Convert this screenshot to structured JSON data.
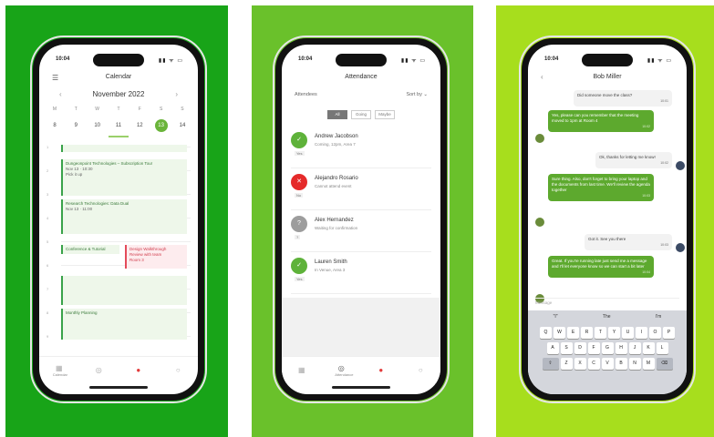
{
  "panels": [
    {
      "name": "calendar-panel",
      "bg": "#18a418"
    },
    {
      "name": "attendance-panel",
      "bg": "#6ac12b"
    },
    {
      "name": "chat-panel",
      "bg": "#a7de1d"
    }
  ],
  "phone1": {
    "status_time": "10:04",
    "status_icons": "▮▮ ᯤ ▭",
    "title": "Calendar",
    "month": "November 2022",
    "weekdays": [
      "M",
      "T",
      "W",
      "T",
      "F",
      "S",
      "S"
    ],
    "days": [
      "8",
      "9",
      "10",
      "11",
      "12",
      "13",
      "14"
    ],
    "selected_day": "13",
    "hours": [
      "1",
      "2",
      "3",
      "4",
      "5",
      "6",
      "7",
      "8",
      "9"
    ],
    "events": [
      {
        "title": "Dungeonpoint Technologies – Subscription Tour",
        "detail": "Nov 13 · 10:30",
        "sub": "Pick it up"
      },
      {
        "title": "Research Technologies: Data Dual",
        "detail": "Nov 13 · 11:00",
        "sub": ""
      },
      {
        "title": "Conference & Tutorial",
        "detail": "",
        "sub": ""
      },
      {
        "title": "Design Walkthrough",
        "detail": "Review with team",
        "sub": "Room 3"
      },
      {
        "title": "Monthly Planning",
        "detail": "",
        "sub": ""
      }
    ],
    "tabs": [
      "Calendar",
      "",
      "",
      ""
    ]
  },
  "phone2": {
    "status_time": "10:04",
    "status_icons": "▮▮ ᯤ ▭",
    "title": "Attendance",
    "filter_left": "Attendees",
    "filter_right": "Sort by ⌄",
    "segments": [
      "All",
      "Going",
      "Maybe"
    ],
    "people": [
      {
        "initial": "✓",
        "name": "Andrew Jacobson",
        "status": "Coming, 12pm, Area 7",
        "color": "green",
        "badge": "Yes"
      },
      {
        "initial": "✕",
        "name": "Alejandro Rosario",
        "status": "Cannot attend event",
        "color": "red",
        "badge": "No"
      },
      {
        "initial": "?",
        "name": "Alex Hernandez",
        "status": "Waiting for confirmation",
        "color": "gray",
        "badge": "?"
      },
      {
        "initial": "✓",
        "name": "Lauren Smith",
        "status": "In Venue, Area 3",
        "color": "green",
        "badge": "Yes"
      }
    ],
    "tabs": [
      "",
      "Attendance",
      "",
      ""
    ]
  },
  "phone3": {
    "status_time": "10:04",
    "status_icons": "▮▮ ᯤ ▭",
    "title": "Bob Miller",
    "messages": [
      {
        "from": "me",
        "text": "Did someone move the class?",
        "ts": "10:01"
      },
      {
        "from": "them",
        "text": "Yes, please can you remember that the meeting moved to 1pm at Room 4",
        "ts": "10:02"
      },
      {
        "from": "me",
        "text": "Ok, thanks for letting me know!",
        "ts": "10:02"
      },
      {
        "from": "them",
        "text": "Sure thing. Also, don't forget to bring your laptop and the documents from last time. We'll review the agenda together",
        "ts": "10:03"
      },
      {
        "from": "me",
        "text": "Got it. See you there",
        "ts": "10:03"
      },
      {
        "from": "them",
        "text": "Great. If you're running late just send me a message and I'll let everyone know so we can start a bit later",
        "ts": "10:04"
      }
    ],
    "input_placeholder": "Message",
    "suggestions": [
      "\"I\"",
      "The",
      "I'm"
    ],
    "keyboard_rows": [
      [
        "Q",
        "W",
        "E",
        "R",
        "T",
        "Y",
        "U",
        "I",
        "O",
        "P"
      ],
      [
        "A",
        "S",
        "D",
        "F",
        "G",
        "H",
        "J",
        "K",
        "L"
      ],
      [
        "⇧",
        "Z",
        "X",
        "C",
        "V",
        "B",
        "N",
        "M",
        "⌫"
      ]
    ]
  }
}
